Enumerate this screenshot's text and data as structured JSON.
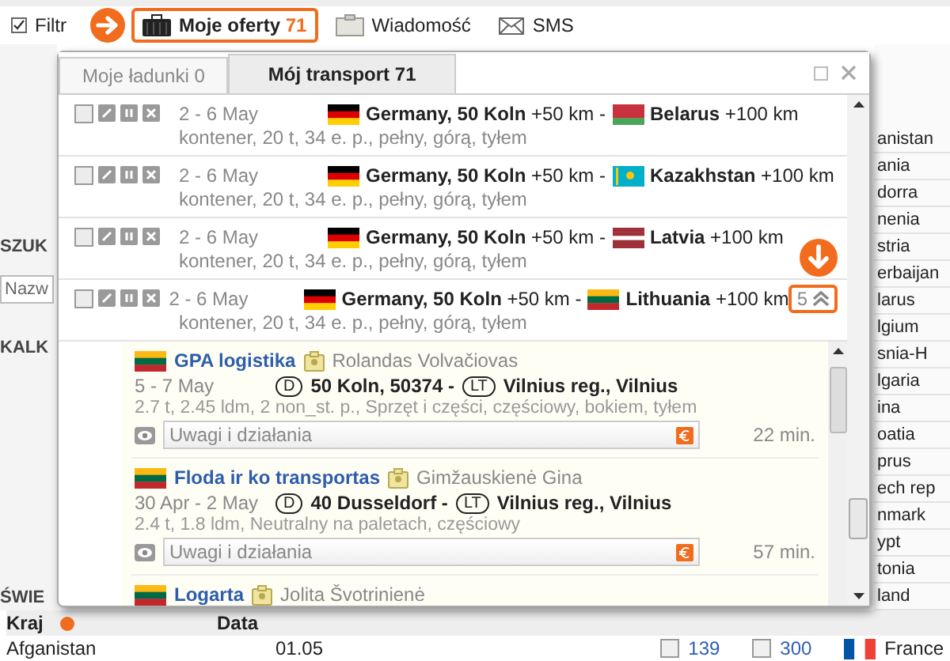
{
  "toolbar": [
    {
      "kind": "filter",
      "label": "Filtr",
      "selected": false
    },
    {
      "kind": "offers",
      "label": "Moje oferty",
      "count": "71",
      "selected": true
    },
    {
      "kind": "messages",
      "label": "Wiadomość",
      "selected": false
    },
    {
      "kind": "sms",
      "label": "SMS",
      "selected": false
    }
  ],
  "left_panel": {
    "headings": [
      "SZUK",
      "KALK"
    ],
    "search": {
      "placeholder": "Nazw"
    },
    "footer_heading": "ŚWIE"
  },
  "country_list": [
    "anistan",
    "ania",
    "dorra",
    "nenia",
    "stria",
    "erbaijan",
    "larus",
    "lgium",
    "snia-H",
    "lgaria",
    "ina",
    "oatia",
    "prus",
    "ech rep",
    "nmark",
    "ypt",
    "tonia",
    "land"
  ],
  "table": {
    "columns": [
      "Kraj",
      "Data"
    ],
    "rows": [
      [
        "Afganistan",
        "01.05"
      ]
    ]
  },
  "bottom_row": {
    "counts": [
      {
        "checked": false,
        "value": "139"
      },
      {
        "checked": false,
        "value": "300"
      }
    ],
    "country": "France",
    "flag": {
      "kind": "fr"
    }
  },
  "popup": {
    "tabs": [
      {
        "label": "Moje ładunki 0",
        "selected": false
      },
      {
        "label": "Mój transport 71",
        "selected": true
      }
    ],
    "offers": [
      {
        "checked": false,
        "date": "2 - 6 May",
        "details": "kontener, 20 t, 34 e. p., pełny, górą, tyłem",
        "from_flag": {
          "kind": "de"
        },
        "from": "**Germany, 50 Koln** +50 km -",
        "to_flag": {
          "kind": "by"
        },
        "to": "**Belarus** +100 km"
      },
      {
        "checked": false,
        "date": "2 - 6 May",
        "details": "kontener, 20 t, 34 e. p., pełny, górą, tyłem",
        "from_flag": {
          "kind": "de"
        },
        "from": "**Germany, 50 Koln** +50 km -",
        "to_flag": {
          "kind": "kz"
        },
        "to": "**Kazakhstan** +100 km"
      },
      {
        "checked": false,
        "date": "2 - 6 May",
        "details": "kontener, 20 t, 34 e. p., pełny, górą, tyłem",
        "from_flag": {
          "kind": "de"
        },
        "from": "**Germany, 50 Koln** +50 km -",
        "to_flag": {
          "kind": "lv"
        },
        "to": "**Latvia** +100 km"
      },
      {
        "checked": false,
        "date": "2 - 6 May",
        "details": "kontener, 20 t, 34 e. p., pełny, górą, tyłem",
        "from_flag": {
          "kind": "de"
        },
        "from": "**Germany, 50 Koln** +50 km -",
        "to_flag": {
          "kind": "lt"
        },
        "to": "**Lithuania** +100 km",
        "expanded": true,
        "responses_count": "5",
        "responses": [
          {
            "flag": {
              "kind": "lt"
            },
            "company": "GPA logistika",
            "contact": "Rolandas Volvačiovas",
            "date": "5 - 7 May",
            "from_code": "D",
            "from": "50 Koln, 50374 -",
            "to_code": "LT",
            "to": "Vilnius reg., Vilnius",
            "details": "2.7 t, 2.45 ldm, 2 non_st. p., Sprzęt i części, częściowy, bokiem, tyłem",
            "notes": {
              "placeholder": "Uwagi i działania"
            },
            "time": "22 min."
          },
          {
            "flag": {
              "kind": "lt"
            },
            "company": "Floda ir ko transportas",
            "contact": "Gimžauskienė Gina",
            "date": "30 Apr - 2 May",
            "from_code": "D",
            "from": "40 Dusseldorf -",
            "to_code": "LT",
            "to": "Vilnius reg., Vilnius",
            "details": "2.4 t, 1.8 ldm, Neutralny na paletach, częściowy",
            "notes": {
              "placeholder": "Uwagi i działania"
            },
            "time": "57 min."
          },
          {
            "flag": {
              "kind": "lt"
            },
            "company": "Logarta",
            "contact": "Jolita Švotrinienė"
          }
        ]
      }
    ]
  }
}
